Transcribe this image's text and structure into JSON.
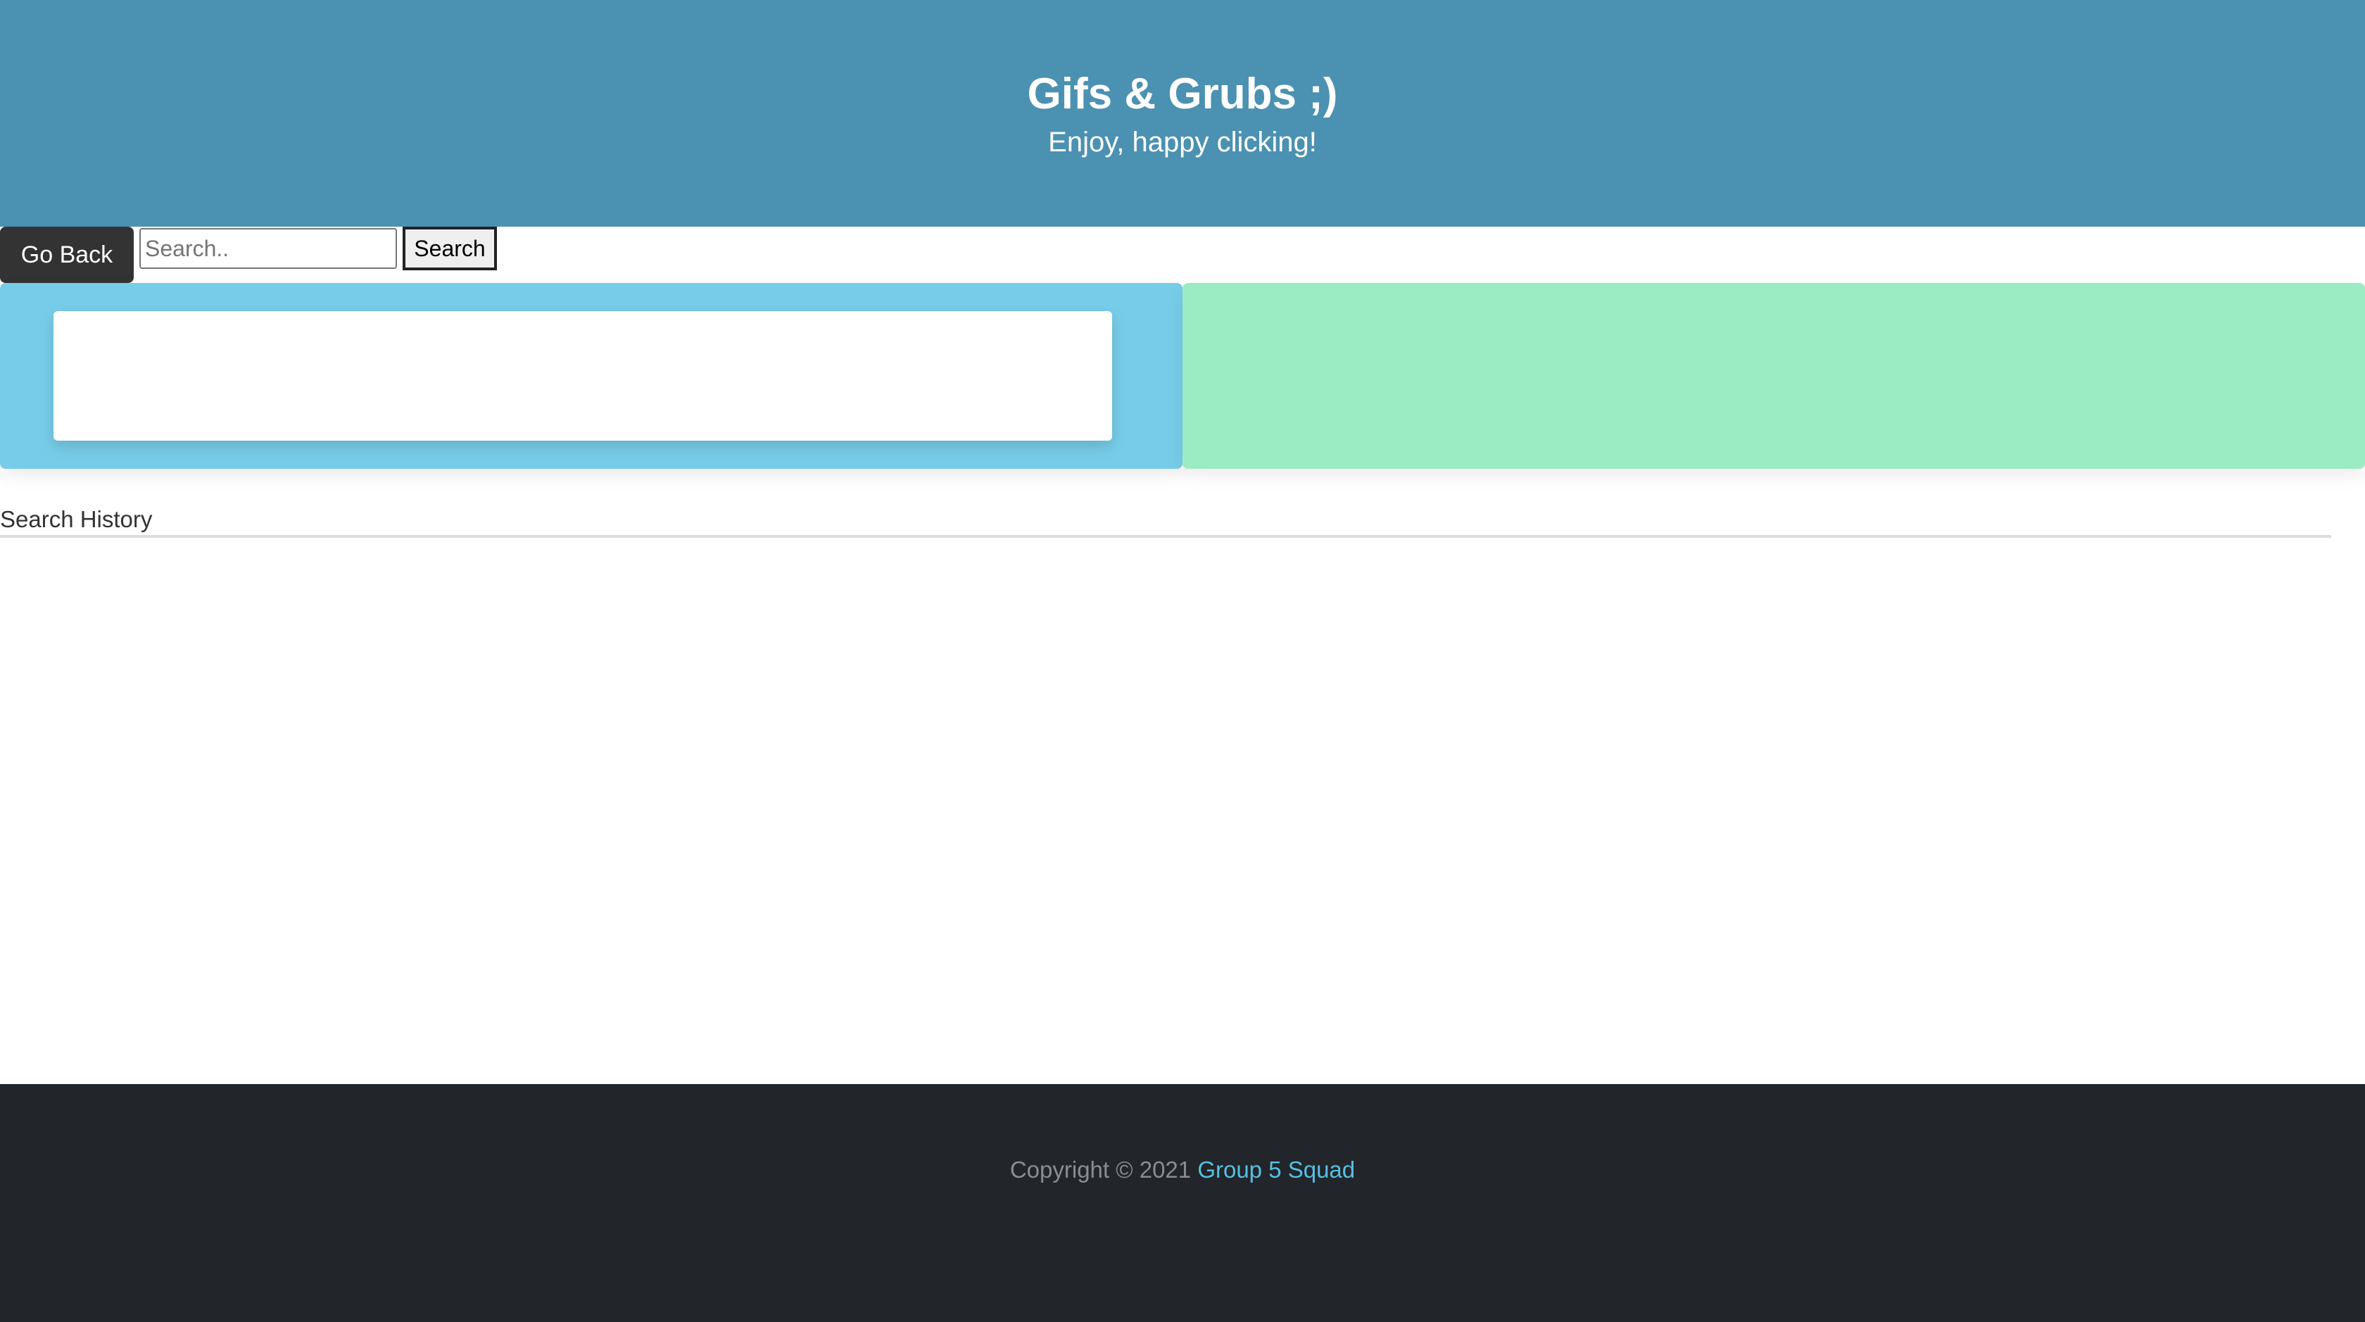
{
  "header": {
    "title": "Gifs & Grubs ;)",
    "subtitle": "Enjoy, happy clicking!"
  },
  "toolbar": {
    "back_label": "Go Back",
    "search_placeholder": "Search..",
    "search_value": "",
    "search_button_label": "Search"
  },
  "history": {
    "heading": "Search History",
    "items": []
  },
  "footer": {
    "copyright": "Copyright © 2021",
    "link_label": "Group 5 Squad"
  },
  "colors": {
    "header_bg": "#4b91b1",
    "left_panel_bg": "#77cde9",
    "right_panel_bg": "#9bebc3",
    "footer_bg": "#22252a",
    "link": "#55c0e2"
  }
}
